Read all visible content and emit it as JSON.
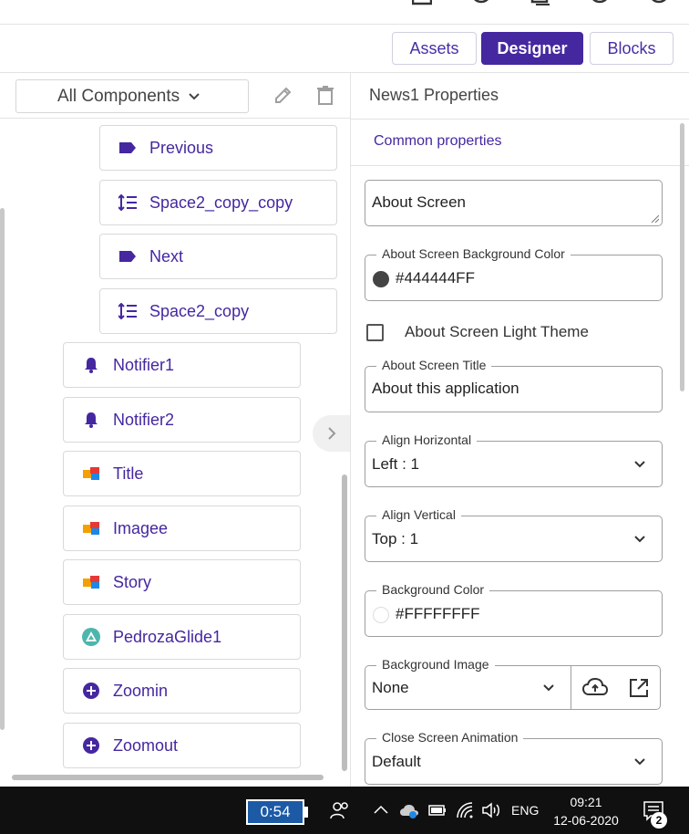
{
  "toolbar": {
    "tabs": [
      {
        "label": "Assets",
        "active": false
      },
      {
        "label": "Designer",
        "active": true
      },
      {
        "label": "Blocks",
        "active": false
      }
    ]
  },
  "components_panel": {
    "filter_label": "All Components",
    "items": [
      {
        "label": "Previous",
        "icon": "tag-icon",
        "level": 2
      },
      {
        "label": "Space2_copy_copy",
        "icon": "vertical-spacing-icon",
        "level": 2
      },
      {
        "label": "Next",
        "icon": "tag-icon",
        "level": 2
      },
      {
        "label": "Space2_copy",
        "icon": "vertical-spacing-icon",
        "level": 2
      },
      {
        "label": "Notifier1",
        "icon": "bell-icon",
        "level": 1
      },
      {
        "label": "Notifier2",
        "icon": "bell-icon",
        "level": 1
      },
      {
        "label": "Title",
        "icon": "cubes-icon",
        "level": 1
      },
      {
        "label": "Imagee",
        "icon": "cubes-icon",
        "level": 1
      },
      {
        "label": "Story",
        "icon": "cubes-icon",
        "level": 1
      },
      {
        "label": "PedrozaGlide1",
        "icon": "triangle-logo-icon",
        "level": 1
      },
      {
        "label": "Zoomin",
        "icon": "plus-circle-icon",
        "level": 1
      },
      {
        "label": "Zoomout",
        "icon": "plus-circle-icon",
        "level": 1
      }
    ]
  },
  "properties_panel": {
    "title": "News1 Properties",
    "section": "Common properties",
    "about_screen": {
      "value": "About Screen"
    },
    "about_bg_color": {
      "label": "About Screen Background Color",
      "value": "#444444FF",
      "swatch": "#444444"
    },
    "light_theme": {
      "label": "About Screen Light Theme",
      "checked": false
    },
    "about_title": {
      "label": "About Screen Title",
      "value": "About this application"
    },
    "align_horizontal": {
      "label": "Align Horizontal",
      "value": "Left : 1"
    },
    "align_vertical": {
      "label": "Align Vertical",
      "value": "Top : 1"
    },
    "bg_color": {
      "label": "Background Color",
      "value": "#FFFFFFFF",
      "swatch": "#FFFFFF"
    },
    "bg_image": {
      "label": "Background Image",
      "value": "None"
    },
    "close_anim": {
      "label": "Close Screen Animation",
      "value": "Default"
    }
  },
  "taskbar": {
    "battery_time": "0:54",
    "language": "ENG",
    "time": "09:21",
    "date": "12-06-2020",
    "notification_count": "2"
  },
  "colors": {
    "accent": "#4527a0",
    "taskbar": "#101010"
  }
}
